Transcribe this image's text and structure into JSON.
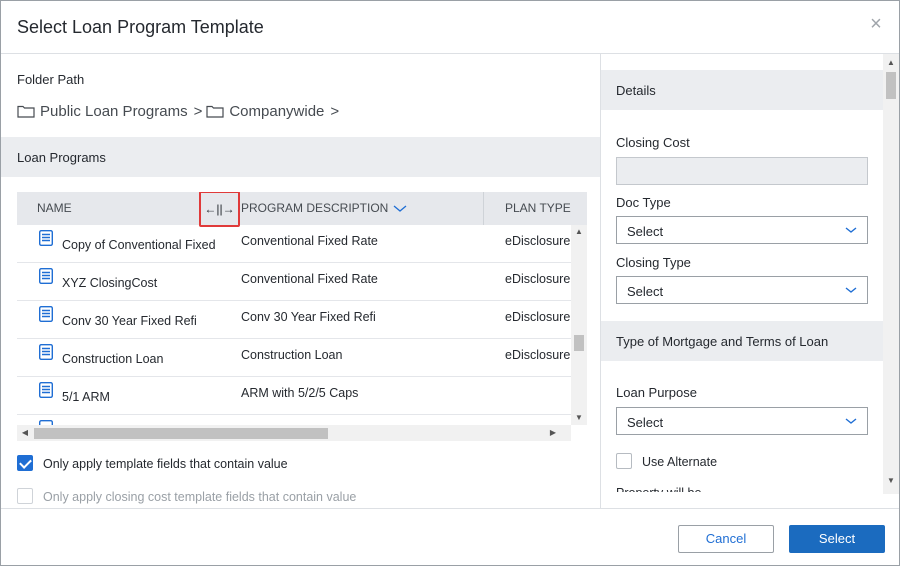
{
  "dialog": {
    "title": "Select Loan Program Template",
    "close_glyph": "×"
  },
  "folder": {
    "label": "Folder Path",
    "segments": [
      "Public Loan Programs",
      "Companywide"
    ],
    "separator": ">"
  },
  "loan_programs": {
    "section_title": "Loan Programs",
    "columns": {
      "name": "NAME",
      "description": "PROGRAM DESCRIPTION",
      "plan_type": "PLAN TYPE"
    },
    "resize_glyph": "←||→",
    "rows": [
      {
        "name": "Copy of Conventional Fixed",
        "description": "Conventional Fixed Rate",
        "plan_type": "eDisclosure"
      },
      {
        "name": "XYZ ClosingCost",
        "description": "Conventional Fixed Rate",
        "plan_type": "eDisclosure"
      },
      {
        "name": "Conv 30 Year Fixed Refi",
        "description": "Conv 30 Year Fixed Refi",
        "plan_type": "eDisclosure"
      },
      {
        "name": "Construction Loan",
        "description": "Construction Loan",
        "plan_type": "eDisclosure"
      },
      {
        "name": "5/1 ARM",
        "description": "ARM with 5/2/5 Caps",
        "plan_type": ""
      }
    ]
  },
  "options": {
    "apply_template_fields": {
      "label": "Only apply template fields that contain value",
      "checked": true
    },
    "apply_closing_cost_fields": {
      "label": "Only apply closing cost template fields that contain value",
      "checked": false
    }
  },
  "details": {
    "section_title": "Details",
    "closing_cost_label": "Closing Cost",
    "closing_cost_value": "",
    "doc_type_label": "Doc Type",
    "doc_type_value": "Select",
    "closing_type_label": "Closing Type",
    "closing_type_value": "Select"
  },
  "mortgage": {
    "section_title": "Type of Mortgage and Terms of Loan",
    "loan_purpose_label": "Loan Purpose",
    "loan_purpose_value": "Select",
    "use_alternate_label": "Use Alternate",
    "property_will_be_label": "Property will be"
  },
  "footer": {
    "cancel_label": "Cancel",
    "select_label": "Select"
  },
  "colors": {
    "accent": "#1b6bbf",
    "checkbox_on": "#1f6ed4",
    "highlight_box": "#e03a3a",
    "row_icon": "#1f6ed4"
  }
}
